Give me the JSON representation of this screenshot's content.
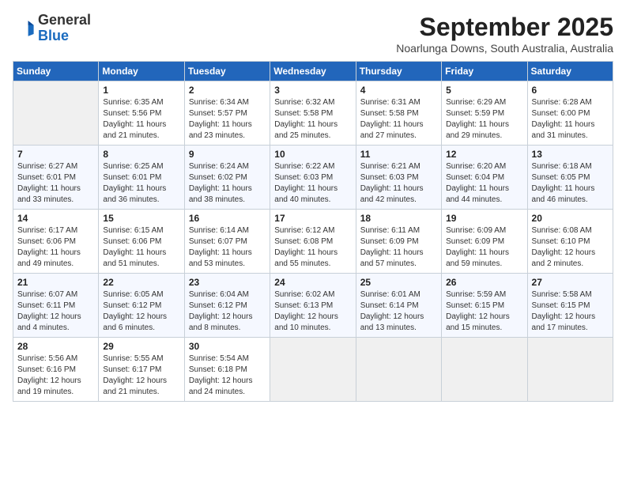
{
  "logo": {
    "general": "General",
    "blue": "Blue"
  },
  "title": "September 2025",
  "location": "Noarlunga Downs, South Australia, Australia",
  "days_of_week": [
    "Sunday",
    "Monday",
    "Tuesday",
    "Wednesday",
    "Thursday",
    "Friday",
    "Saturday"
  ],
  "weeks": [
    [
      {
        "day": "",
        "info": ""
      },
      {
        "day": "1",
        "info": "Sunrise: 6:35 AM\nSunset: 5:56 PM\nDaylight: 11 hours\nand 21 minutes."
      },
      {
        "day": "2",
        "info": "Sunrise: 6:34 AM\nSunset: 5:57 PM\nDaylight: 11 hours\nand 23 minutes."
      },
      {
        "day": "3",
        "info": "Sunrise: 6:32 AM\nSunset: 5:58 PM\nDaylight: 11 hours\nand 25 minutes."
      },
      {
        "day": "4",
        "info": "Sunrise: 6:31 AM\nSunset: 5:58 PM\nDaylight: 11 hours\nand 27 minutes."
      },
      {
        "day": "5",
        "info": "Sunrise: 6:29 AM\nSunset: 5:59 PM\nDaylight: 11 hours\nand 29 minutes."
      },
      {
        "day": "6",
        "info": "Sunrise: 6:28 AM\nSunset: 6:00 PM\nDaylight: 11 hours\nand 31 minutes."
      }
    ],
    [
      {
        "day": "7",
        "info": "Sunrise: 6:27 AM\nSunset: 6:01 PM\nDaylight: 11 hours\nand 33 minutes."
      },
      {
        "day": "8",
        "info": "Sunrise: 6:25 AM\nSunset: 6:01 PM\nDaylight: 11 hours\nand 36 minutes."
      },
      {
        "day": "9",
        "info": "Sunrise: 6:24 AM\nSunset: 6:02 PM\nDaylight: 11 hours\nand 38 minutes."
      },
      {
        "day": "10",
        "info": "Sunrise: 6:22 AM\nSunset: 6:03 PM\nDaylight: 11 hours\nand 40 minutes."
      },
      {
        "day": "11",
        "info": "Sunrise: 6:21 AM\nSunset: 6:03 PM\nDaylight: 11 hours\nand 42 minutes."
      },
      {
        "day": "12",
        "info": "Sunrise: 6:20 AM\nSunset: 6:04 PM\nDaylight: 11 hours\nand 44 minutes."
      },
      {
        "day": "13",
        "info": "Sunrise: 6:18 AM\nSunset: 6:05 PM\nDaylight: 11 hours\nand 46 minutes."
      }
    ],
    [
      {
        "day": "14",
        "info": "Sunrise: 6:17 AM\nSunset: 6:06 PM\nDaylight: 11 hours\nand 49 minutes."
      },
      {
        "day": "15",
        "info": "Sunrise: 6:15 AM\nSunset: 6:06 PM\nDaylight: 11 hours\nand 51 minutes."
      },
      {
        "day": "16",
        "info": "Sunrise: 6:14 AM\nSunset: 6:07 PM\nDaylight: 11 hours\nand 53 minutes."
      },
      {
        "day": "17",
        "info": "Sunrise: 6:12 AM\nSunset: 6:08 PM\nDaylight: 11 hours\nand 55 minutes."
      },
      {
        "day": "18",
        "info": "Sunrise: 6:11 AM\nSunset: 6:09 PM\nDaylight: 11 hours\nand 57 minutes."
      },
      {
        "day": "19",
        "info": "Sunrise: 6:09 AM\nSunset: 6:09 PM\nDaylight: 11 hours\nand 59 minutes."
      },
      {
        "day": "20",
        "info": "Sunrise: 6:08 AM\nSunset: 6:10 PM\nDaylight: 12 hours\nand 2 minutes."
      }
    ],
    [
      {
        "day": "21",
        "info": "Sunrise: 6:07 AM\nSunset: 6:11 PM\nDaylight: 12 hours\nand 4 minutes."
      },
      {
        "day": "22",
        "info": "Sunrise: 6:05 AM\nSunset: 6:12 PM\nDaylight: 12 hours\nand 6 minutes."
      },
      {
        "day": "23",
        "info": "Sunrise: 6:04 AM\nSunset: 6:12 PM\nDaylight: 12 hours\nand 8 minutes."
      },
      {
        "day": "24",
        "info": "Sunrise: 6:02 AM\nSunset: 6:13 PM\nDaylight: 12 hours\nand 10 minutes."
      },
      {
        "day": "25",
        "info": "Sunrise: 6:01 AM\nSunset: 6:14 PM\nDaylight: 12 hours\nand 13 minutes."
      },
      {
        "day": "26",
        "info": "Sunrise: 5:59 AM\nSunset: 6:15 PM\nDaylight: 12 hours\nand 15 minutes."
      },
      {
        "day": "27",
        "info": "Sunrise: 5:58 AM\nSunset: 6:15 PM\nDaylight: 12 hours\nand 17 minutes."
      }
    ],
    [
      {
        "day": "28",
        "info": "Sunrise: 5:56 AM\nSunset: 6:16 PM\nDaylight: 12 hours\nand 19 minutes."
      },
      {
        "day": "29",
        "info": "Sunrise: 5:55 AM\nSunset: 6:17 PM\nDaylight: 12 hours\nand 21 minutes."
      },
      {
        "day": "30",
        "info": "Sunrise: 5:54 AM\nSunset: 6:18 PM\nDaylight: 12 hours\nand 24 minutes."
      },
      {
        "day": "",
        "info": ""
      },
      {
        "day": "",
        "info": ""
      },
      {
        "day": "",
        "info": ""
      },
      {
        "day": "",
        "info": ""
      }
    ]
  ]
}
